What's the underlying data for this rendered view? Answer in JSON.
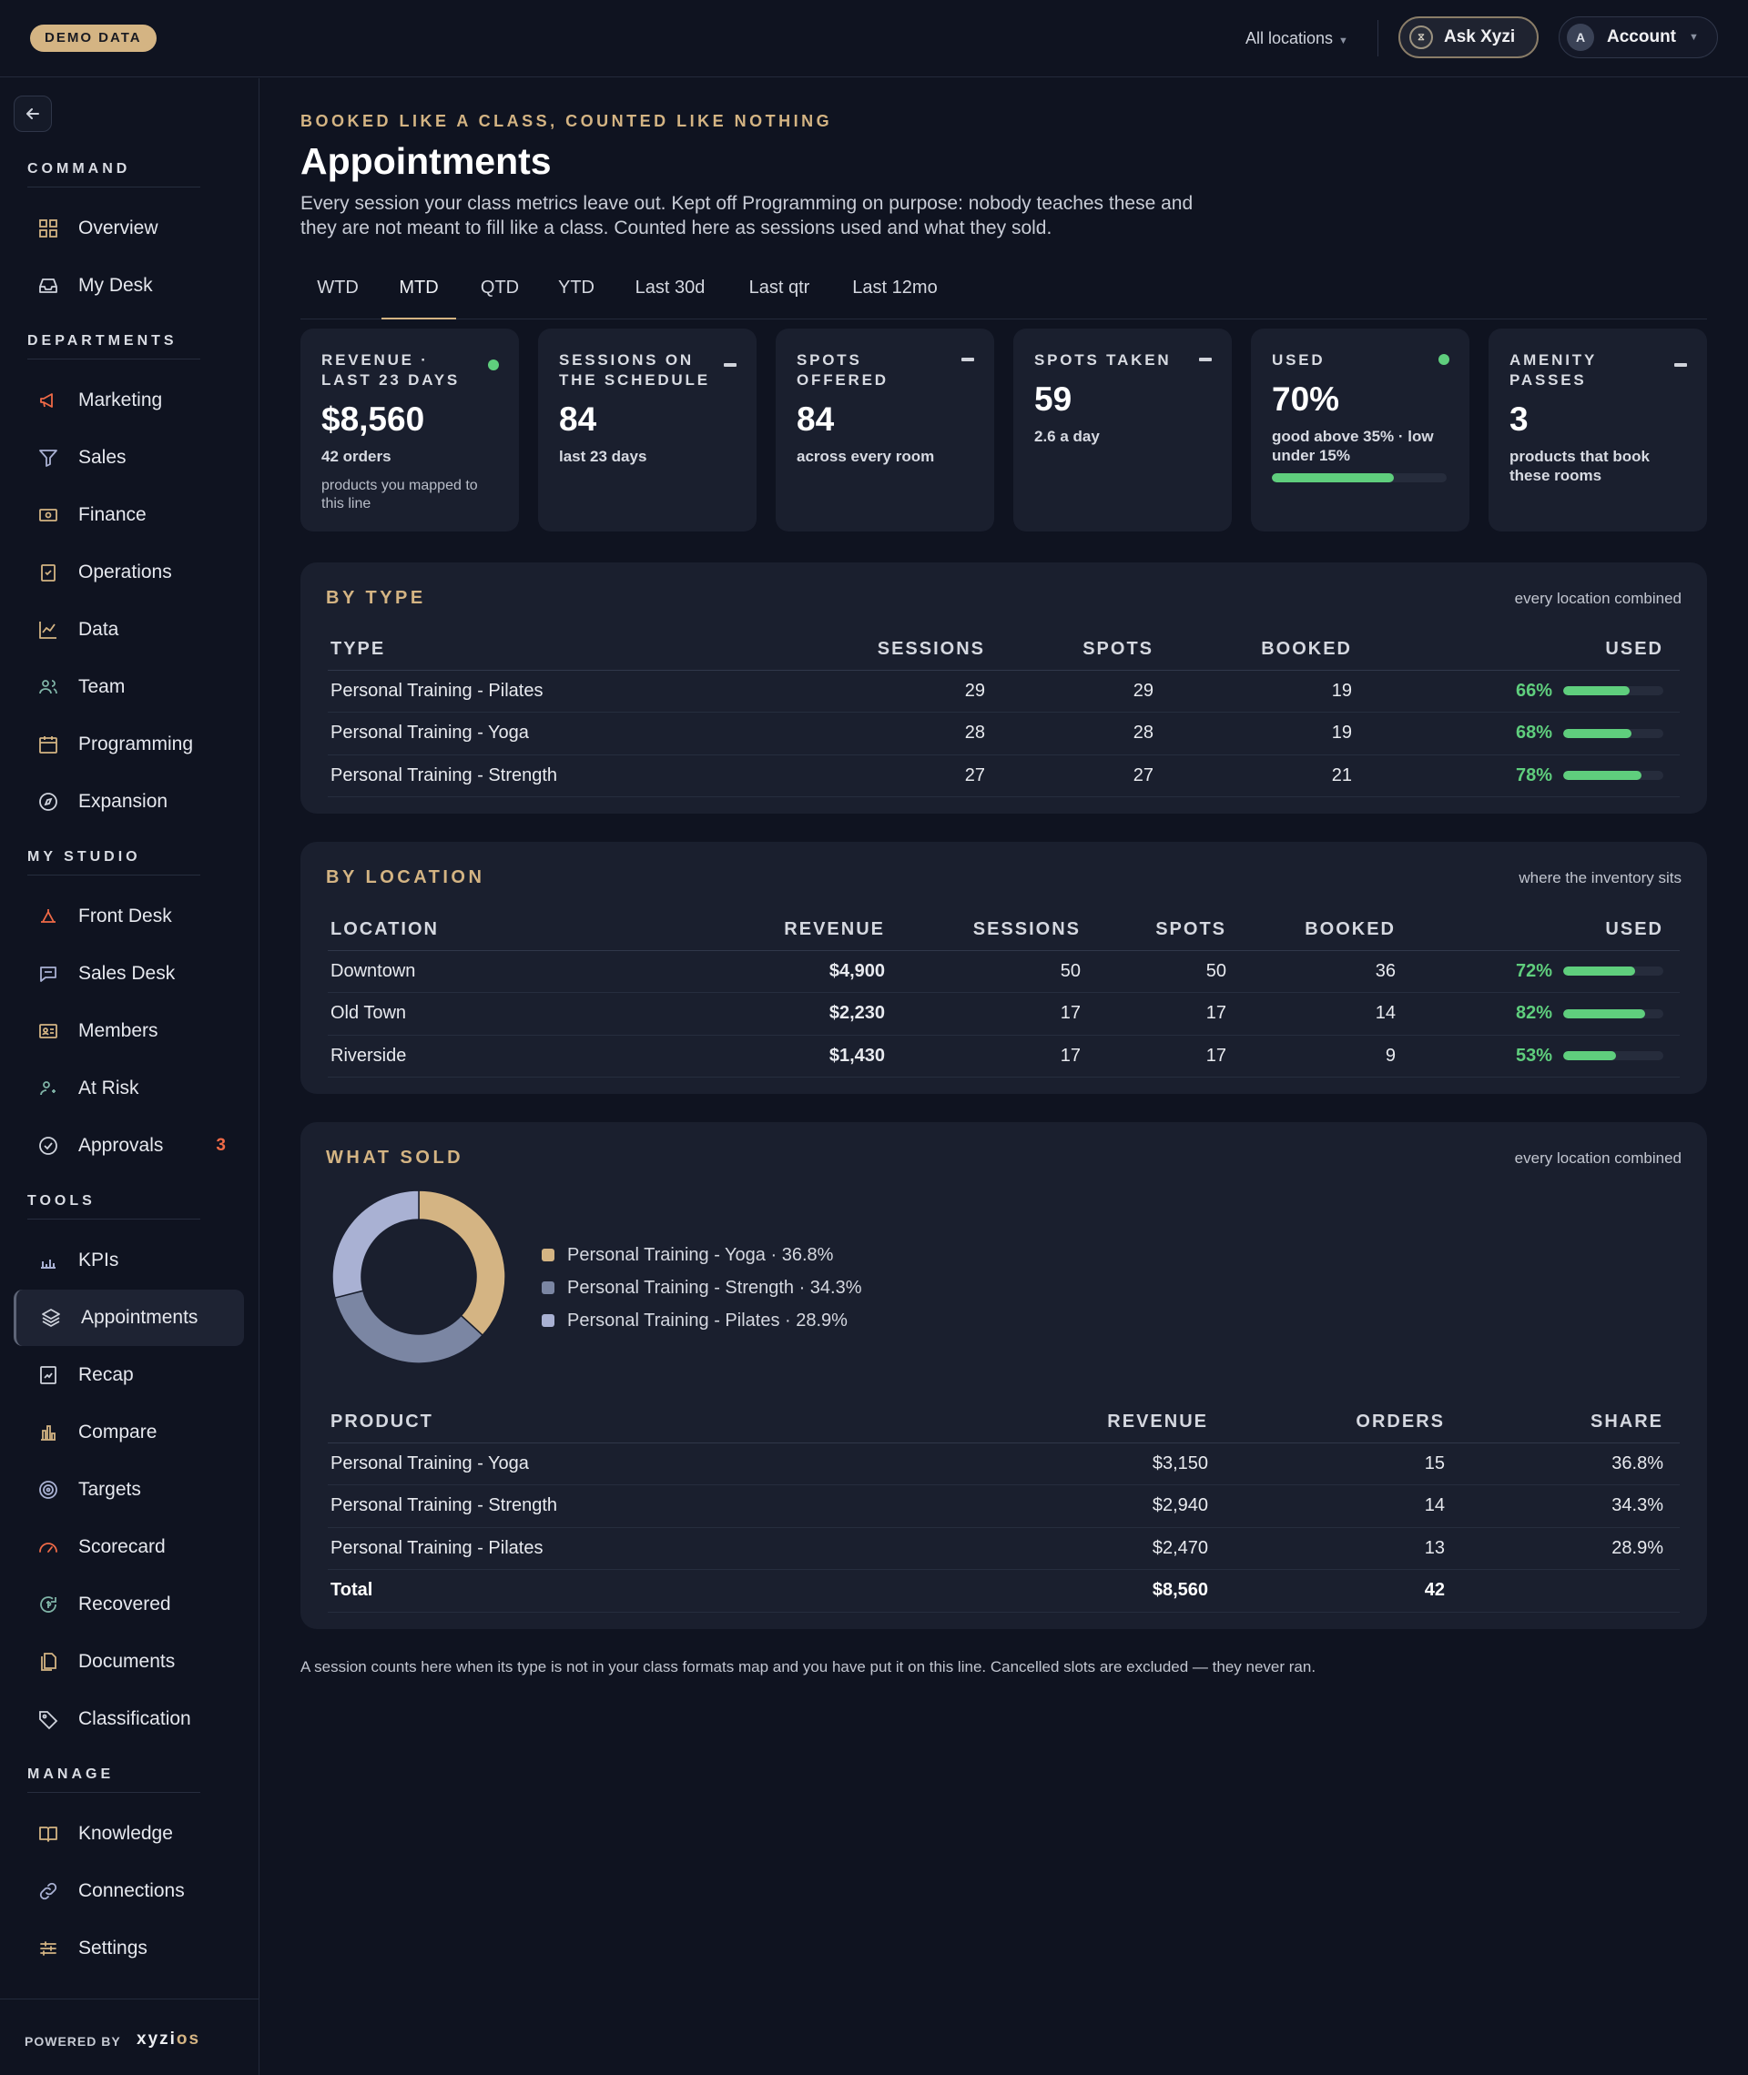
{
  "topbar": {
    "badge": "DEMO DATA",
    "location": "All locations",
    "ask": "Ask Xyzi",
    "account_initial": "A",
    "account": "Account"
  },
  "sidebar": {
    "sections": [
      {
        "label": "COMMAND",
        "items": [
          {
            "label": "Overview",
            "icon": "grid-icon"
          },
          {
            "label": "My Desk",
            "icon": "inbox-icon"
          }
        ]
      },
      {
        "label": "DEPARTMENTS",
        "items": [
          {
            "label": "Marketing",
            "icon": "megaphone-icon"
          },
          {
            "label": "Sales",
            "icon": "funnel-icon"
          },
          {
            "label": "Finance",
            "icon": "banknote-icon"
          },
          {
            "label": "Operations",
            "icon": "clipboard-icon"
          },
          {
            "label": "Data",
            "icon": "line-chart-icon"
          },
          {
            "label": "Team",
            "icon": "users-icon"
          },
          {
            "label": "Programming",
            "icon": "calendar-icon"
          },
          {
            "label": "Expansion",
            "icon": "compass-icon"
          }
        ]
      },
      {
        "label": "MY STUDIO",
        "items": [
          {
            "label": "Front Desk",
            "icon": "bell-icon"
          },
          {
            "label": "Sales Desk",
            "icon": "chat-icon"
          },
          {
            "label": "Members",
            "icon": "id-card-icon"
          },
          {
            "label": "At Risk",
            "icon": "user-alert-icon"
          },
          {
            "label": "Approvals",
            "icon": "check-circle-icon",
            "badge": "3"
          }
        ]
      },
      {
        "label": "TOOLS",
        "items": [
          {
            "label": "KPIs",
            "icon": "bar-chart-icon"
          },
          {
            "label": "Appointments",
            "icon": "layers-icon",
            "active": true
          },
          {
            "label": "Recap",
            "icon": "doc-chart-icon"
          },
          {
            "label": "Compare",
            "icon": "columns-icon"
          },
          {
            "label": "Targets",
            "icon": "target-icon"
          },
          {
            "label": "Scorecard",
            "icon": "gauge-icon"
          },
          {
            "label": "Recovered",
            "icon": "refresh-icon"
          },
          {
            "label": "Documents",
            "icon": "files-icon"
          },
          {
            "label": "Classification",
            "icon": "tag-icon"
          }
        ]
      },
      {
        "label": "MANAGE",
        "items": [
          {
            "label": "Knowledge",
            "icon": "book-icon"
          },
          {
            "label": "Connections",
            "icon": "link-icon"
          },
          {
            "label": "Settings",
            "icon": "sliders-icon"
          }
        ]
      }
    ],
    "powered_by": "POWERED BY",
    "logo_a": "xyzi",
    "logo_b": "os"
  },
  "header": {
    "eyebrow": "BOOKED LIKE A CLASS, COUNTED LIKE NOTHING",
    "title": "Appointments",
    "description": "Every session your class metrics leave out. Kept off Programming on purpose: nobody teaches these and they are not meant to fill like a class. Counted here as sessions used and what they sold."
  },
  "tabs": [
    {
      "label": "WTD"
    },
    {
      "label": "MTD",
      "active": true
    },
    {
      "label": "QTD"
    },
    {
      "label": "YTD"
    },
    {
      "label": "Last 30d"
    },
    {
      "label": "Last qtr"
    },
    {
      "label": "Last 12mo"
    }
  ],
  "kpis": [
    {
      "label": "REVENUE · LAST 23 DAYS",
      "value": "$8,560",
      "sub": "42 orders",
      "note": "products you mapped to this line",
      "status": "dot"
    },
    {
      "label": "SESSIONS ON THE SCHEDULE",
      "value": "84",
      "sub": "last 23 days",
      "status": "dash"
    },
    {
      "label": "SPOTS OFFERED",
      "value": "84",
      "sub": "across every room",
      "status": "dash"
    },
    {
      "label": "SPOTS TAKEN",
      "value": "59",
      "sub": "2.6 a day",
      "status": "dash"
    },
    {
      "label": "USED",
      "value": "70%",
      "sub": "good above 35% · low under 15%",
      "status": "dot",
      "progress": 0.7
    },
    {
      "label": "AMENITY PASSES",
      "value": "3",
      "sub": "products that book these rooms",
      "status": "dash"
    }
  ],
  "by_type": {
    "title": "BY TYPE",
    "note": "every location combined",
    "headers": [
      "TYPE",
      "SESSIONS",
      "SPOTS",
      "BOOKED",
      "USED"
    ],
    "rows": [
      {
        "type": "Personal Training - Pilates",
        "sessions": "29",
        "spots": "29",
        "booked": "19",
        "used": "66%",
        "frac": 0.66
      },
      {
        "type": "Personal Training - Yoga",
        "sessions": "28",
        "spots": "28",
        "booked": "19",
        "used": "68%",
        "frac": 0.68
      },
      {
        "type": "Personal Training - Strength",
        "sessions": "27",
        "spots": "27",
        "booked": "21",
        "used": "78%",
        "frac": 0.78
      }
    ]
  },
  "by_location": {
    "title": "BY LOCATION",
    "note": "where the inventory sits",
    "headers": [
      "LOCATION",
      "REVENUE",
      "SESSIONS",
      "SPOTS",
      "BOOKED",
      "USED"
    ],
    "rows": [
      {
        "location": "Downtown",
        "revenue": "$4,900",
        "sessions": "50",
        "spots": "50",
        "booked": "36",
        "used": "72%",
        "frac": 0.72
      },
      {
        "location": "Old Town",
        "revenue": "$2,230",
        "sessions": "17",
        "spots": "17",
        "booked": "14",
        "used": "82%",
        "frac": 0.82
      },
      {
        "location": "Riverside",
        "revenue": "$1,430",
        "sessions": "17",
        "spots": "17",
        "booked": "9",
        "used": "53%",
        "frac": 0.53
      }
    ]
  },
  "what_sold": {
    "title": "WHAT SOLD",
    "note": "every location combined",
    "legend": [
      {
        "label": "Personal Training - Yoga · 36.8%",
        "color": "#d4b483",
        "share": 36.8
      },
      {
        "label": "Personal Training - Strength · 34.3%",
        "color": "#7b86a3",
        "share": 34.3
      },
      {
        "label": "Personal Training - Pilates · 28.9%",
        "color": "#a9b1d3",
        "share": 28.9
      }
    ],
    "headers": [
      "PRODUCT",
      "REVENUE",
      "ORDERS",
      "SHARE"
    ],
    "rows": [
      {
        "product": "Personal Training - Yoga",
        "revenue": "$3,150",
        "orders": "15",
        "share": "36.8%"
      },
      {
        "product": "Personal Training - Strength",
        "revenue": "$2,940",
        "orders": "14",
        "share": "34.3%"
      },
      {
        "product": "Personal Training - Pilates",
        "revenue": "$2,470",
        "orders": "13",
        "share": "28.9%"
      }
    ],
    "total": {
      "label": "Total",
      "revenue": "$8,560",
      "orders": "42",
      "share": ""
    }
  },
  "footnote": "A session counts here when its type is not in your class formats map and you have put it on this line. Cancelled slots are excluded — they never ran.",
  "colors": {
    "accent": "#d4b483",
    "good": "#5fce7d",
    "alert": "#ef6a47"
  }
}
